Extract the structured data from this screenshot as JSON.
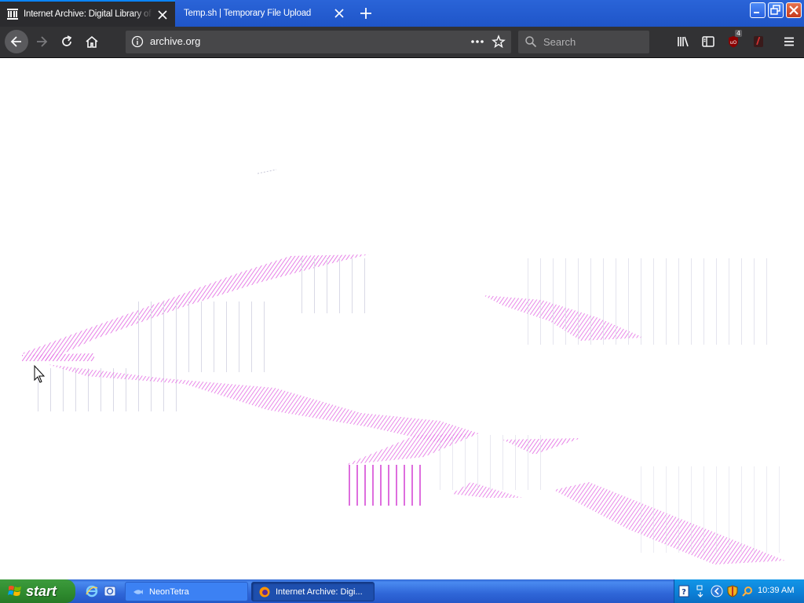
{
  "browser": {
    "tabs": [
      {
        "title": "Internet Archive: Digital Library of Free & Borrowable Books",
        "active": true
      },
      {
        "title": "Temp.sh | Temporary File Upload",
        "active": false
      }
    ],
    "url": "archive.org",
    "search_placeholder": "Search",
    "ublock_badge": "4"
  },
  "taskbar": {
    "start_label": "start",
    "items": [
      {
        "label": "NeonTetra"
      },
      {
        "label": "Internet Archive: Digi..."
      }
    ],
    "clock": "10:39 AM"
  },
  "colors": {
    "accent_tab": "#0a84ff",
    "artifact": "#e040e0",
    "taskbar": "#2f66d8",
    "start": "#2e8a2e"
  }
}
